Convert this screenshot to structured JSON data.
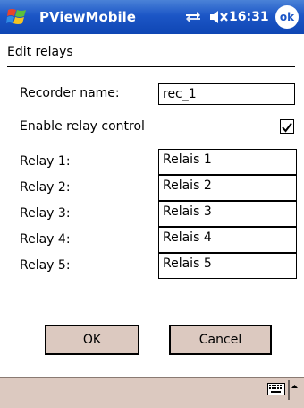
{
  "titlebar": {
    "app_title": "PViewMobile",
    "clock": "16:31",
    "ok_label": "ok",
    "icons": [
      "windows-start-icon",
      "connectivity-icon",
      "volume-off-icon"
    ]
  },
  "page": {
    "heading": "Edit relays"
  },
  "form": {
    "recorder_label": "Recorder name:",
    "recorder_value": "rec_1",
    "enable_label": "Enable relay control",
    "enable_checked": true,
    "relays": [
      {
        "label": "Relay 1:",
        "value": "Relais 1"
      },
      {
        "label": "Relay 2:",
        "value": "Relais 2"
      },
      {
        "label": "Relay 3:",
        "value": "Relais 3"
      },
      {
        "label": "Relay 4:",
        "value": "Relais 4"
      },
      {
        "label": "Relay 5:",
        "value": "Relais 5"
      }
    ]
  },
  "buttons": {
    "ok_label": "OK",
    "cancel_label": "Cancel"
  },
  "colors": {
    "titlebar": "#1c56c6",
    "button_face": "#dcc9c0",
    "menubar": "#dcc9c0"
  }
}
